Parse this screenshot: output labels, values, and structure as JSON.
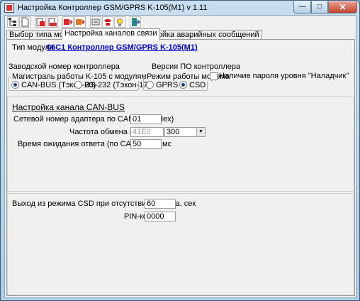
{
  "window": {
    "title": "Настройка Контроллер GSM/GPRS K-105(M1)   v 1.11"
  },
  "tabs": [
    "Выбор типа модуля",
    "Настройка каналов связи",
    "Настройка аварийных сообщений"
  ],
  "module": {
    "type_label": "Тип модуля",
    "type_value": "06С1 Контроллер GSM/GPRS K-105(M1)"
  },
  "serial": {
    "label": "Заводской номер контроллера",
    "fw_label": "Версия ПО контроллера"
  },
  "interface_group": {
    "caption": "Магистраль работы K-105 с модулями",
    "options": [
      "CAN-BUS (Тэкон-20)",
      "RS-232 (Тэкон-17)"
    ],
    "selected": "CAN-BUS (Тэкон-20)"
  },
  "modem_group": {
    "caption": "Режим работы модема",
    "options": [
      "GPRS",
      "CSD"
    ],
    "selected": "CSD"
  },
  "password_checkbox": {
    "label": "Наличие пароля уровня \"Наладчик\"",
    "checked": false
  },
  "canbus": {
    "title": "Настройка  канала CAN-BUS",
    "address_label": "Сетевой номер адаптера по  CAN-BUS  (Hex)",
    "address_value": "01",
    "rate_label": "Частота обмена (Кбод)",
    "rate_disabled_value": "41E0",
    "rate_select_value": "300",
    "timeout_label": "Время ожидания ответа (по CAN-BUS), мс",
    "timeout_value": "50"
  },
  "csd": {
    "exit_label": "Выход из режима CSD при отсутствии обмена, сек",
    "exit_value": "60",
    "pin_label": "PIN-код",
    "pin_value": "0000"
  }
}
